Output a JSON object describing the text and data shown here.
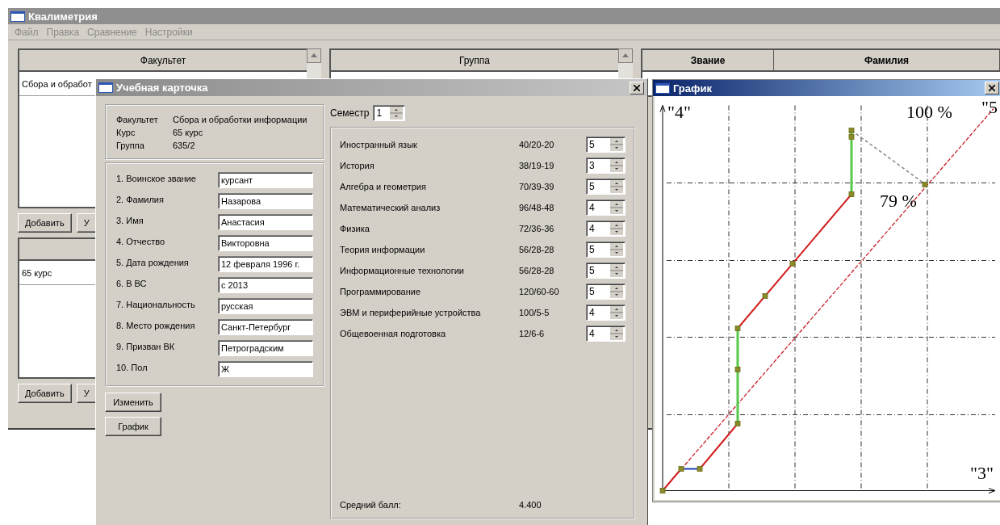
{
  "main_window": {
    "title": "Квалиметрия",
    "menu": [
      "Файл",
      "Правка",
      "Сравнение",
      "Настройки"
    ],
    "faculty_list": {
      "header": "Факультет",
      "rows": [
        "Сбора и обработ"
      ]
    },
    "faculty_buttons": [
      "Добавить",
      "У"
    ],
    "course_list": {
      "rows": [
        "65 курс"
      ]
    },
    "course_buttons": [
      "Добавить",
      "У"
    ],
    "group_list": {
      "header": "Группа"
    },
    "staff_table": {
      "columns": [
        "Звание",
        "Фамилия"
      ]
    }
  },
  "card_dialog": {
    "title": "Учебная карточка",
    "info": [
      {
        "label": "Факультет",
        "value": "Сбора и обработки информации"
      },
      {
        "label": "Курс",
        "value": "65 курс"
      },
      {
        "label": "Группа",
        "value": "635/2"
      }
    ],
    "fields": [
      {
        "label": "1. Воинское звание",
        "value": "курсант"
      },
      {
        "label": "2. Фамилия",
        "value": "Назарова"
      },
      {
        "label": "3. Имя",
        "value": "Анастасия"
      },
      {
        "label": "4. Отчество",
        "value": "Викторовна"
      },
      {
        "label": "5. Дата рождения",
        "value": "12 февраля 1996 г."
      },
      {
        "label": "6. В ВС",
        "value": "с 2013"
      },
      {
        "label": "7. Национальность",
        "value": "русская"
      },
      {
        "label": "8. Место рождения",
        "value": "Санкт-Петербург"
      },
      {
        "label": "9. Призван ВК",
        "value": "Петроградским"
      },
      {
        "label": "10. Пол",
        "value": "Ж"
      }
    ],
    "buttons": [
      "Изменить",
      "График"
    ],
    "semester": {
      "label": "Семестр",
      "value": "1"
    },
    "subjects": [
      {
        "name": "Иностранный язык",
        "hours": "40/20-20",
        "grade": "5"
      },
      {
        "name": "История",
        "hours": "38/19-19",
        "grade": "3"
      },
      {
        "name": "Алгебра и геометрия",
        "hours": "70/39-39",
        "grade": "5"
      },
      {
        "name": "Математический анализ",
        "hours": "96/48-48",
        "grade": "4"
      },
      {
        "name": "Физика",
        "hours": "72/36-36",
        "grade": "4"
      },
      {
        "name": "Теория информации",
        "hours": "56/28-28",
        "grade": "5"
      },
      {
        "name": "Информационные технологии",
        "hours": "56/28-28",
        "grade": "5"
      },
      {
        "name": "Программирование",
        "hours": "120/60-60",
        "grade": "5"
      },
      {
        "name": "ЭВМ и периферийные устройства",
        "hours": "100/5-5",
        "grade": "4"
      },
      {
        "name": "Общевоенная подготовка",
        "hours": "12/6-6",
        "grade": "4"
      }
    ],
    "average": {
      "label": "Средний балл:",
      "value": "4.400"
    }
  },
  "graph_window": {
    "title": "График",
    "y_axis_label": "\"4\"",
    "top_percent": "100 %",
    "corner_label": "\"5",
    "mid_percent": "79 %",
    "x_axis_label": "\"3\""
  }
}
